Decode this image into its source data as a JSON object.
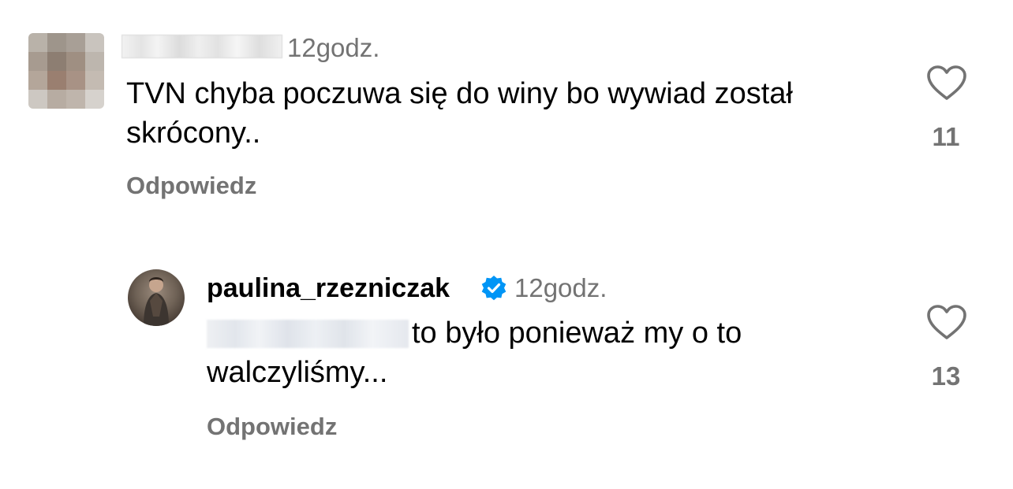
{
  "comments": [
    {
      "time": "12godz.",
      "text": "TVN chyba poczuwa się do winy bo wywiad został skrócony..",
      "reply_label": "Odpowiedz",
      "likes": "11",
      "avatar_icon": "pixelated-avatar",
      "username_redacted": true
    },
    {
      "username": "paulina_rzezniczak",
      "verified": true,
      "time": "12godz.",
      "text_line1": "to było ponieważ my o to",
      "text_line2": "walczyliśmy...",
      "reply_label": "Odpowiedz",
      "likes": "13",
      "mention_redacted": true
    }
  ],
  "colors": {
    "secondary_text": "#737373",
    "verified_badge": "#0095f6"
  }
}
